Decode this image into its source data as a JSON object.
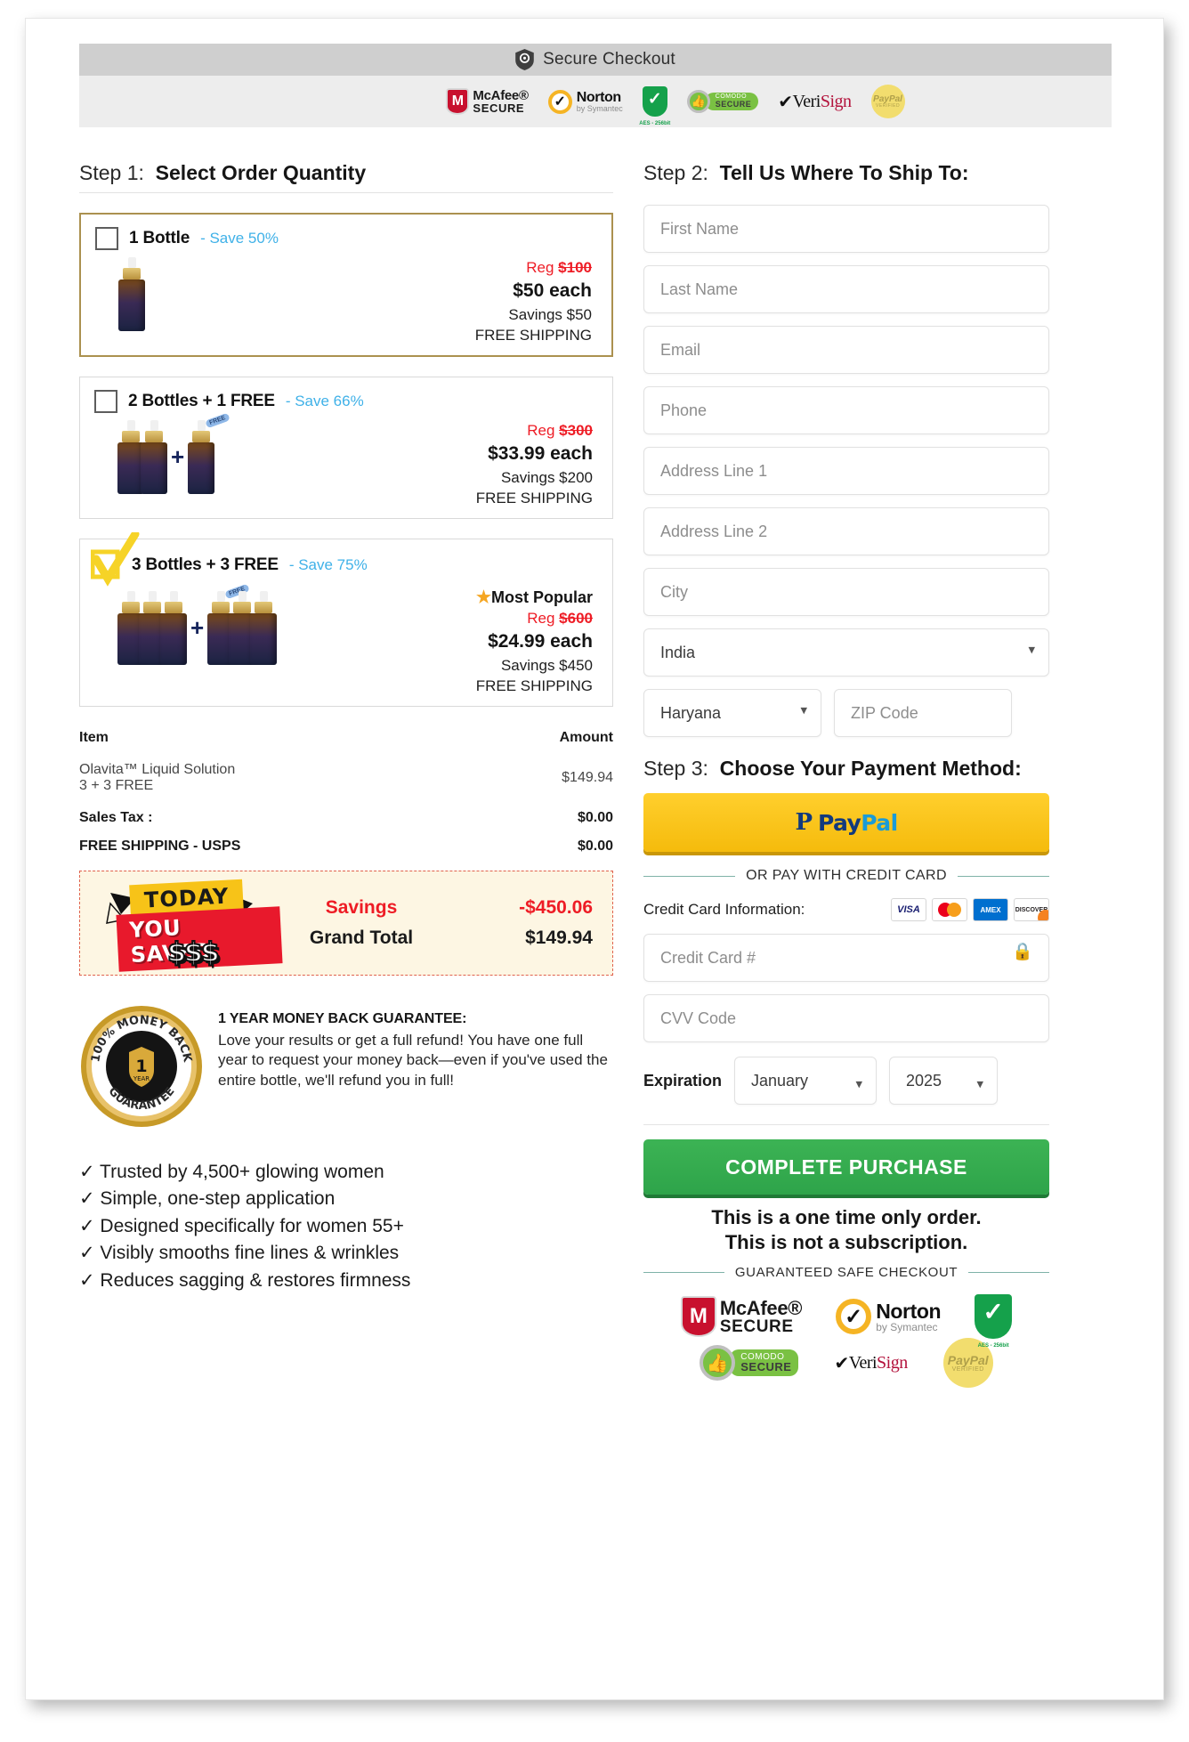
{
  "header": {
    "secure_title": "Secure Checkout",
    "shield_icon": "shield-check-icon",
    "badges": [
      {
        "name": "mcafee-secure-badge",
        "line1": "McAfee®",
        "line2": "SECURE",
        "mark": "M"
      },
      {
        "name": "norton-symantec-badge",
        "line1": "Norton",
        "line2": "by Symantec",
        "mark": "✔"
      },
      {
        "name": "green-shield-badge",
        "mark": "✔",
        "caption": "AES - 256bit"
      },
      {
        "name": "comodo-secure-badge",
        "line1": "COMODO",
        "line2": "SECURE",
        "mark": "👍"
      },
      {
        "name": "verisign-badge",
        "text_dark": "Veri",
        "text_red": "Sign"
      },
      {
        "name": "paypal-verified-badge",
        "line1": "PayPal",
        "line2": "VERIFIED"
      }
    ]
  },
  "step1": {
    "label": "Step 1:",
    "title": "Select Order Quantity",
    "offers": [
      {
        "name": "1 Bottle",
        "save": "- Save 50%",
        "reg_label": "Reg",
        "reg_price": "$100",
        "each": "$50 each",
        "savings": "Savings $50",
        "shipping": "FREE SHIPPING",
        "selected": false,
        "popular": "",
        "bottle_count": 1,
        "free_tag": ""
      },
      {
        "name": "2 Bottles + 1 FREE",
        "save": "- Save 66%",
        "reg_label": "Reg",
        "reg_price": "$300",
        "each": "$33.99 each",
        "savings": "Savings $200",
        "shipping": "FREE SHIPPING",
        "selected": false,
        "popular": "",
        "bottle_count": 3,
        "free_tag": "FREE"
      },
      {
        "name": "3 Bottles + 3 FREE",
        "save": "- Save 75%",
        "reg_label": "Reg",
        "reg_price": "$600",
        "each": "$24.99 each",
        "savings": "Savings $450",
        "shipping": "FREE SHIPPING",
        "selected": true,
        "popular": "Most Popular",
        "bottle_count": 6,
        "free_tag": "FREE"
      }
    ]
  },
  "summary": {
    "col_item": "Item",
    "col_amount": "Amount",
    "rows": [
      {
        "label_line1": "Olavita™ Liquid Solution",
        "label_line2": "3 + 3 FREE",
        "amount": "$149.94"
      },
      {
        "label_line1": "Sales Tax :",
        "label_line2": "",
        "amount": "$0.00"
      },
      {
        "label_line1": "FREE SHIPPING - USPS",
        "label_line2": "",
        "amount": "$0.00"
      }
    ],
    "sticker": {
      "l1": "TODAY",
      "l2": "YOU SAVED",
      "l3": "$$$"
    },
    "savings_label": "Savings",
    "savings_value": "-$450.06",
    "grand_label": "Grand Total",
    "grand_value": "$149.94"
  },
  "guarantee": {
    "seal_top": "100% MONEY BACK",
    "seal_bottom": "GUARANTEE",
    "seal_center": "1",
    "seal_center_sub": "YEAR",
    "heading": "1 YEAR MONEY BACK GUARANTEE:",
    "body": "Love your results or get a full refund! You have one full year to request your money back—even if you've used the entire bottle, we'll refund you in full!"
  },
  "benefits": [
    "✓ Trusted by 4,500+ glowing women",
    "✓ Simple, one-step application",
    "✓ Designed specifically for women 55+",
    "✓ Visibly smooths fine lines & wrinkles",
    "✓ Reduces sagging & restores firmness"
  ],
  "step2": {
    "label": "Step 2:",
    "title": "Tell Us Where To Ship To:",
    "first_name_placeholder": "First Name",
    "last_name_placeholder": "Last Name",
    "email_placeholder": "Email",
    "phone_placeholder": "Phone",
    "address1_placeholder": "Address Line 1",
    "address2_placeholder": "Address Line 2",
    "city_placeholder": "City",
    "country_value": "India",
    "state_value": "Haryana",
    "zip_placeholder": "ZIP Code"
  },
  "step3": {
    "label": "Step 3:",
    "title": "Choose Your Payment Method:",
    "paypal_label": "PayPal",
    "or_divider": "OR PAY WITH CREDIT CARD",
    "cc_info_label": "Credit Card Information:",
    "cards": [
      "VISA",
      "mastercard",
      "AMEX",
      "DISCOVER"
    ],
    "cc_number_placeholder": "Credit Card #",
    "cc_lock_icon": "lock-icon",
    "cvv_placeholder": "CVV Code",
    "expiration_label": "Expiration",
    "expiration_month": "January",
    "expiration_year": "2025",
    "buy_label": "COMPLETE PURCHASE",
    "onetime_line1": "This is a one time only order.",
    "onetime_line2": "This is not a subscription.",
    "safe_divider": "GUARANTEED SAFE CHECKOUT"
  },
  "colors": {
    "accent_blue": "#3fb1e8",
    "red": "#ee1c25",
    "gold_border": "#ab914f",
    "paypal_yellow": "#f5bb0c",
    "buy_green": "#2ea44a",
    "savings_bg": "#fdf6e3"
  }
}
